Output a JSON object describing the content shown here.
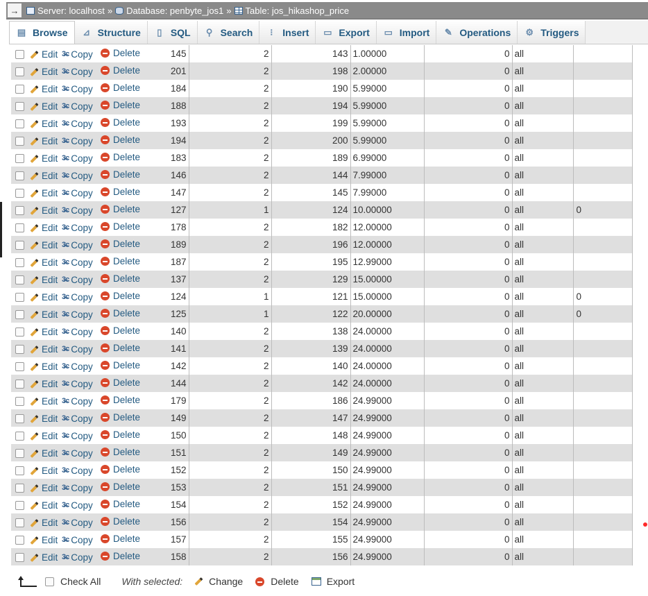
{
  "breadcrumb": {
    "server": "Server: localhost",
    "database": "Database: penbyte_jos1",
    "table": "Table: jos_hikashop_price",
    "separator": "»",
    "collapse": "→"
  },
  "tabs": [
    {
      "label": "Browse",
      "icon": "browse-icon"
    },
    {
      "label": "Structure",
      "icon": "structure-icon"
    },
    {
      "label": "SQL",
      "icon": "sql-icon"
    },
    {
      "label": "Search",
      "icon": "search-icon"
    },
    {
      "label": "Insert",
      "icon": "insert-icon"
    },
    {
      "label": "Export",
      "icon": "export-icon"
    },
    {
      "label": "Import",
      "icon": "import-icon"
    },
    {
      "label": "Operations",
      "icon": "wrench-icon"
    },
    {
      "label": "Triggers",
      "icon": "triggers-icon"
    }
  ],
  "row_actions": {
    "edit": "Edit",
    "copy": "Copy",
    "delete": "Delete"
  },
  "rows": [
    {
      "id": "145",
      "c2": "2",
      "c3": "143",
      "price": "1.00000",
      "c5": "0",
      "c6": "all",
      "c7": ""
    },
    {
      "id": "201",
      "c2": "2",
      "c3": "198",
      "price": "2.00000",
      "c5": "0",
      "c6": "all",
      "c7": ""
    },
    {
      "id": "184",
      "c2": "2",
      "c3": "190",
      "price": "5.99000",
      "c5": "0",
      "c6": "all",
      "c7": ""
    },
    {
      "id": "188",
      "c2": "2",
      "c3": "194",
      "price": "5.99000",
      "c5": "0",
      "c6": "all",
      "c7": ""
    },
    {
      "id": "193",
      "c2": "2",
      "c3": "199",
      "price": "5.99000",
      "c5": "0",
      "c6": "all",
      "c7": ""
    },
    {
      "id": "194",
      "c2": "2",
      "c3": "200",
      "price": "5.99000",
      "c5": "0",
      "c6": "all",
      "c7": ""
    },
    {
      "id": "183",
      "c2": "2",
      "c3": "189",
      "price": "6.99000",
      "c5": "0",
      "c6": "all",
      "c7": ""
    },
    {
      "id": "146",
      "c2": "2",
      "c3": "144",
      "price": "7.99000",
      "c5": "0",
      "c6": "all",
      "c7": ""
    },
    {
      "id": "147",
      "c2": "2",
      "c3": "145",
      "price": "7.99000",
      "c5": "0",
      "c6": "all",
      "c7": ""
    },
    {
      "id": "127",
      "c2": "1",
      "c3": "124",
      "price": "10.00000",
      "c5": "0",
      "c6": "all",
      "c7": "0"
    },
    {
      "id": "178",
      "c2": "2",
      "c3": "182",
      "price": "12.00000",
      "c5": "0",
      "c6": "all",
      "c7": ""
    },
    {
      "id": "189",
      "c2": "2",
      "c3": "196",
      "price": "12.00000",
      "c5": "0",
      "c6": "all",
      "c7": ""
    },
    {
      "id": "187",
      "c2": "2",
      "c3": "195",
      "price": "12.99000",
      "c5": "0",
      "c6": "all",
      "c7": ""
    },
    {
      "id": "137",
      "c2": "2",
      "c3": "129",
      "price": "15.00000",
      "c5": "0",
      "c6": "all",
      "c7": ""
    },
    {
      "id": "124",
      "c2": "1",
      "c3": "121",
      "price": "15.00000",
      "c5": "0",
      "c6": "all",
      "c7": "0"
    },
    {
      "id": "125",
      "c2": "1",
      "c3": "122",
      "price": "20.00000",
      "c5": "0",
      "c6": "all",
      "c7": "0"
    },
    {
      "id": "140",
      "c2": "2",
      "c3": "138",
      "price": "24.00000",
      "c5": "0",
      "c6": "all",
      "c7": ""
    },
    {
      "id": "141",
      "c2": "2",
      "c3": "139",
      "price": "24.00000",
      "c5": "0",
      "c6": "all",
      "c7": ""
    },
    {
      "id": "142",
      "c2": "2",
      "c3": "140",
      "price": "24.00000",
      "c5": "0",
      "c6": "all",
      "c7": ""
    },
    {
      "id": "144",
      "c2": "2",
      "c3": "142",
      "price": "24.00000",
      "c5": "0",
      "c6": "all",
      "c7": ""
    },
    {
      "id": "179",
      "c2": "2",
      "c3": "186",
      "price": "24.99000",
      "c5": "0",
      "c6": "all",
      "c7": ""
    },
    {
      "id": "149",
      "c2": "2",
      "c3": "147",
      "price": "24.99000",
      "c5": "0",
      "c6": "all",
      "c7": ""
    },
    {
      "id": "150",
      "c2": "2",
      "c3": "148",
      "price": "24.99000",
      "c5": "0",
      "c6": "all",
      "c7": ""
    },
    {
      "id": "151",
      "c2": "2",
      "c3": "149",
      "price": "24.99000",
      "c5": "0",
      "c6": "all",
      "c7": ""
    },
    {
      "id": "152",
      "c2": "2",
      "c3": "150",
      "price": "24.99000",
      "c5": "0",
      "c6": "all",
      "c7": ""
    },
    {
      "id": "153",
      "c2": "2",
      "c3": "151",
      "price": "24.99000",
      "c5": "0",
      "c6": "all",
      "c7": ""
    },
    {
      "id": "154",
      "c2": "2",
      "c3": "152",
      "price": "24.99000",
      "c5": "0",
      "c6": "all",
      "c7": ""
    },
    {
      "id": "156",
      "c2": "2",
      "c3": "154",
      "price": "24.99000",
      "c5": "0",
      "c6": "all",
      "c7": ""
    },
    {
      "id": "157",
      "c2": "2",
      "c3": "155",
      "price": "24.99000",
      "c5": "0",
      "c6": "all",
      "c7": ""
    },
    {
      "id": "158",
      "c2": "2",
      "c3": "156",
      "price": "24.99000",
      "c5": "0",
      "c6": "all",
      "c7": ""
    }
  ],
  "footer": {
    "check_all": "Check All",
    "with_selected": "With selected:",
    "change": "Change",
    "delete": "Delete",
    "export": "Export"
  },
  "colors": {
    "link": "#235a81",
    "row_alt": "#dfdfdf",
    "delete_icon": "#d9472b",
    "topbar": "#8a8a8a"
  }
}
